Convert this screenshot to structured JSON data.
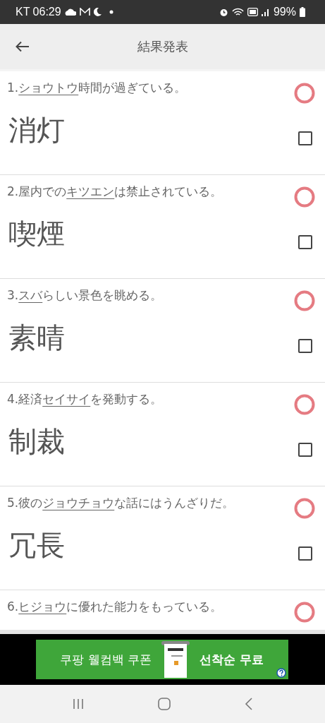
{
  "status_bar": {
    "carrier_time": "KT 06:29",
    "battery": "99%"
  },
  "app_bar": {
    "title": "結果発表"
  },
  "questions": [
    {
      "before": "1.",
      "reading": "ショウトウ",
      "after": "時間が過ぎている。",
      "correct": true,
      "answer": "消灯",
      "checked": false
    },
    {
      "before": "2.屋内での",
      "reading": "キツエン",
      "after": "は禁止されている。",
      "correct": true,
      "answer": "喫煙",
      "checked": false
    },
    {
      "before": "3.",
      "reading": "スバ",
      "after": "らしい景色を眺める。",
      "correct": true,
      "answer": "素晴",
      "checked": false
    },
    {
      "before": "4.経済",
      "reading": "セイサイ",
      "after": "を発動する。",
      "correct": true,
      "answer": "制裁",
      "checked": false
    },
    {
      "before": "5.彼の",
      "reading": "ジョウチョウ",
      "after": "な話にはうんざりだ。",
      "correct": true,
      "answer": "冗長",
      "checked": false
    },
    {
      "before": "6.",
      "reading": "ヒジョウ",
      "after": "に優れた能力をもっている。",
      "correct": true
    }
  ],
  "ad": {
    "left_text": "쿠팡 웰컴백 쿠폰",
    "right_text": "선착순 무료"
  }
}
